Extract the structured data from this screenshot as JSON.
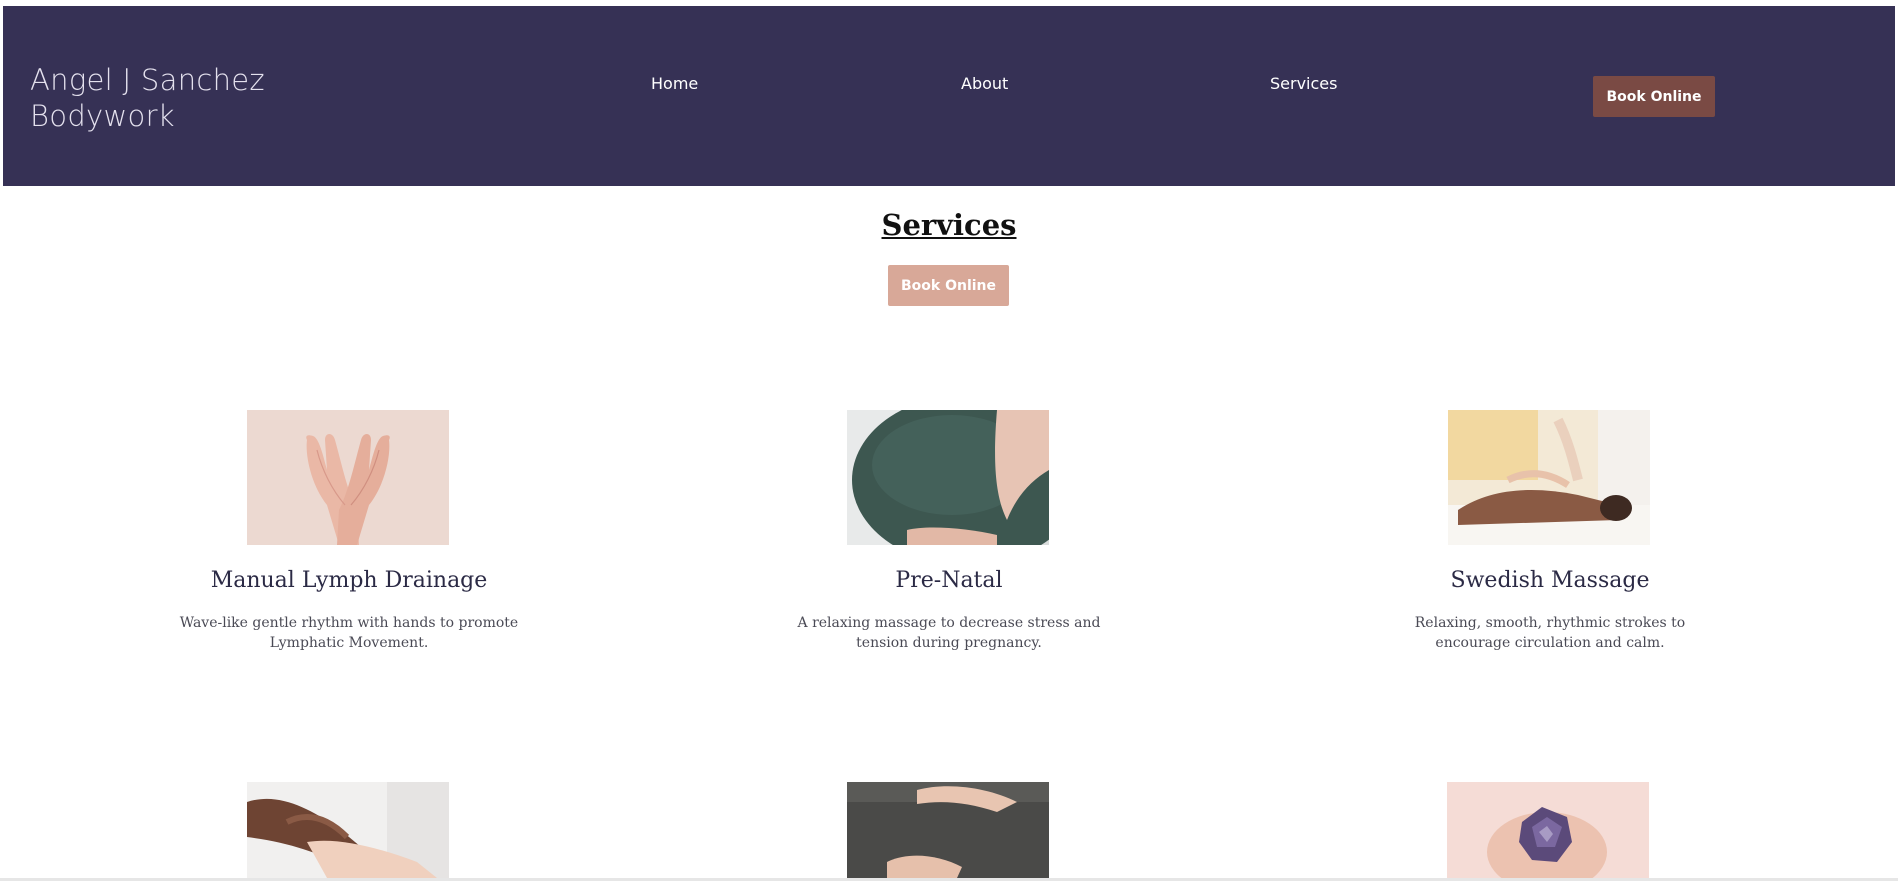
{
  "header": {
    "brand_line1": "Angel J Sanchez",
    "brand_line2": "Bodywork",
    "nav": [
      "Home",
      "About",
      "Services"
    ],
    "book_label": "Book Online",
    "bg_color": "#363155",
    "book_color": "#7a4a44"
  },
  "main": {
    "title": "Services",
    "book_label": "Book Online",
    "book_color": "#d8a898"
  },
  "services": [
    {
      "name": "Manual Lymph Drainage",
      "description": "Wave-like gentle rhythm with hands to promote Lymphatic Movement.",
      "image": "open-palms-photo"
    },
    {
      "name": "Pre-Natal",
      "description": "A relaxing massage to decrease stress and tension during pregnancy.",
      "image": "pregnant-belly-photo"
    },
    {
      "name": "Swedish Massage",
      "description": "Relaxing, smooth, rhythmic strokes to encourage circulation and calm.",
      "image": "back-massage-photo"
    },
    {
      "image": "hand-massage-photo"
    },
    {
      "image": "belly-hands-photo"
    },
    {
      "image": "crystal-in-hands-photo"
    }
  ]
}
